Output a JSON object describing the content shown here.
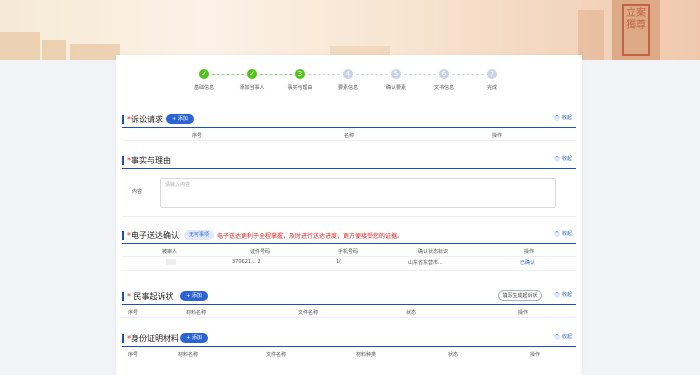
{
  "banner": {
    "seal_text": "立案獨尊"
  },
  "steps": [
    {
      "label": "基础信息",
      "num": "",
      "done": true
    },
    {
      "label": "添加当事人",
      "num": "",
      "done": true
    },
    {
      "label": "事实与理由",
      "num": "3",
      "done": true
    },
    {
      "label": "要素信息",
      "num": "4",
      "done": false
    },
    {
      "label": "确认要素",
      "num": "5",
      "done": false
    },
    {
      "label": "文书信息",
      "num": "6",
      "done": false
    },
    {
      "label": "完成",
      "num": "7",
      "done": false
    }
  ],
  "claims": {
    "title": "诉讼请求",
    "add_label": "+ 添加",
    "collapse_label": "收起",
    "columns": [
      "序号",
      "名称",
      "操作"
    ]
  },
  "facts": {
    "title": "事实与理由",
    "collapse_label": "收起",
    "field_label": "内容",
    "placeholder": "请输入内容"
  },
  "delivery": {
    "title": "电子送达确认",
    "tag": "无可事项",
    "notice": "电子送达更利于全程掌握，及时进行送达进度，更方便接受您的证据。",
    "collapse_label": "收起",
    "columns": [
      "被审人",
      "证件号码",
      "手机号码",
      "确认状态标识",
      "操作"
    ],
    "row": {
      "name": "",
      "id": "370621...  2",
      "phone": "1(",
      "status": "山东省东营市...",
      "action": "已确认"
    }
  },
  "complaint": {
    "title": "民事起诉状",
    "upload_label": "+ 添加",
    "gen_label": "填写生成起诉状",
    "collapse_label": "收起",
    "columns": [
      "序号",
      "材料名称",
      "文件名称",
      "状态",
      "操作"
    ]
  },
  "identity": {
    "title": "身份证明材料",
    "add_label": "+ 添加",
    "collapse_label": "收起",
    "columns": [
      "序号",
      "材料名称",
      "文件名称",
      "材料种类",
      "状态",
      "操作"
    ]
  }
}
